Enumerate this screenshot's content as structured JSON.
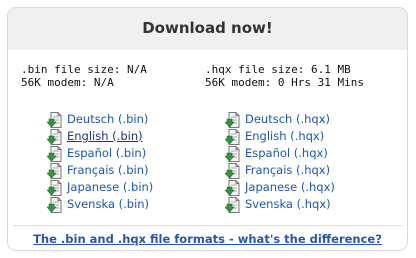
{
  "title": "Download now!",
  "info": {
    "bin": {
      "size": ".bin file size: N/A",
      "modem": "56K modem: N/A"
    },
    "hqx": {
      "size": ".hqx file size: 6.1 MB",
      "modem": "56K modem: 0 Hrs 31 Mins"
    }
  },
  "bin_links": [
    "Deutsch (.bin)",
    "English (.bin)",
    "Español (.bin)",
    "Français (.bin)",
    "Japanese (.bin)",
    "Svenska (.bin)"
  ],
  "hqx_links": [
    "Deutsch (.hqx)",
    "English (.hqx)",
    "Español (.hqx)",
    "Français (.hqx)",
    "Japanese (.hqx)",
    "Svenska (.hqx)"
  ],
  "footer_link": "The .bin and .hqx file formats - what's the difference?",
  "colors": {
    "link": "#1b56b7",
    "header_bg": "#f0f0f0",
    "border": "#d2dce6",
    "icon_arrow": "#2d9a3a"
  },
  "icon": "download-file-icon"
}
